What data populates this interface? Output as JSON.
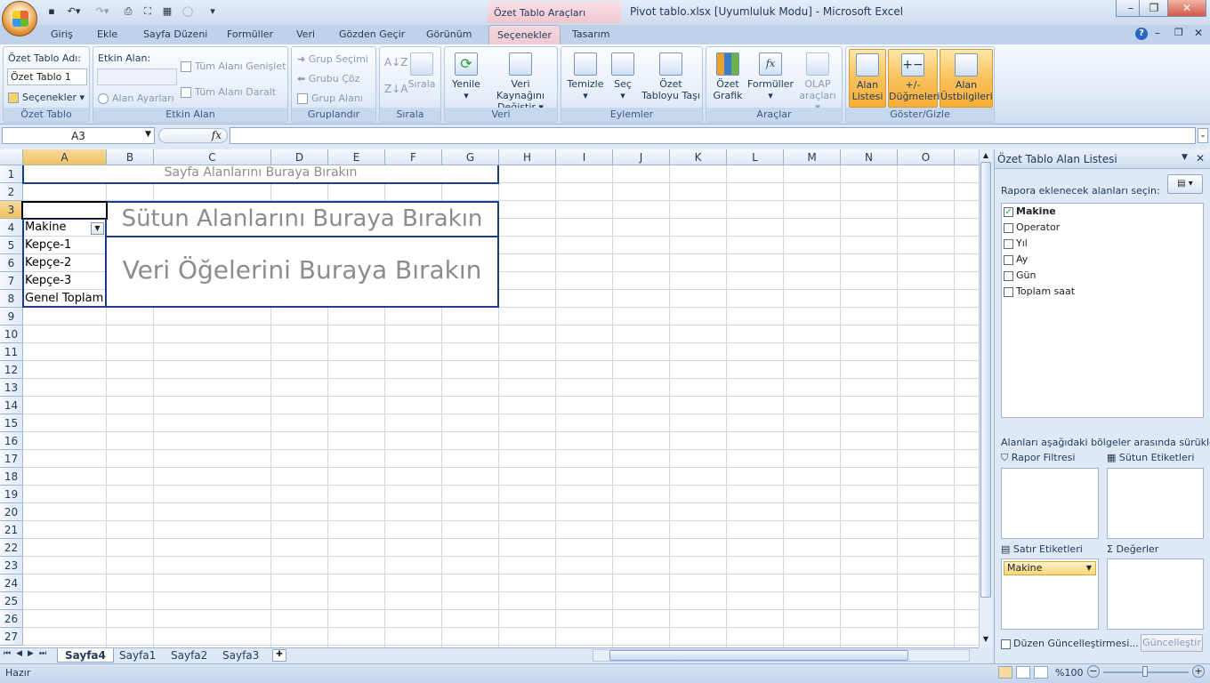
{
  "window": {
    "title": "Pivot tablo.xlsx  [Uyumluluk Modu] - Microsoft Excel",
    "contextual_tab_group": "Özet Tablo Araçları"
  },
  "tabs": [
    "Giriş",
    "Ekle",
    "Sayfa Düzeni",
    "Formüller",
    "Veri",
    "Gözden Geçir",
    "Görünüm",
    "Seçenekler",
    "Tasarım"
  ],
  "active_tab": "Seçenekler",
  "ribbon": {
    "ozet_tablo": {
      "name_label": "Özet Tablo Adı:",
      "name_value": "Özet Tablo 1",
      "options_label": "Seçenekler",
      "group_label": "Özet Tablo"
    },
    "etkin_alan": {
      "active_field_label": "Etkin Alan:",
      "field_settings": "Alan Ayarları",
      "expand_all": "Tüm Alanı Genişlet",
      "collapse_all": "Tüm Alanı Daralt",
      "group_label": "Etkin Alan"
    },
    "gruplandir": {
      "group_selection": "Grup Seçimi",
      "ungroup": "Grubu Çöz",
      "group_field": "Grup Alanı",
      "group_label": "Gruplandır"
    },
    "sirala": {
      "sort": "Sırala",
      "group_label": "Sırala"
    },
    "veri": {
      "refresh": "Yenile",
      "change_source_line1": "Veri Kaynağını",
      "change_source_line2": "Değiştir",
      "group_label": "Veri"
    },
    "eylemler": {
      "clear": "Temizle",
      "select": "Seç",
      "move_line1": "Özet",
      "move_line2": "Tabloyu Taşı",
      "group_label": "Eylemler"
    },
    "araclar": {
      "chart_line1": "Özet",
      "chart_line2": "Grafik",
      "formulas": "Formüller",
      "olap_line1": "OLAP",
      "olap_line2": "araçları",
      "group_label": "Araçlar"
    },
    "goster_gizle": {
      "field_list_line1": "Alan",
      "field_list_line2": "Listesi",
      "buttons_line1": "+/-",
      "buttons_line2": "Düğmeleri",
      "headers_line1": "Alan",
      "headers_line2": "Üstbilgileri",
      "group_label": "Göster/Gizle"
    }
  },
  "formula_bar": {
    "name_box": "A3",
    "fx": "fx",
    "value": ""
  },
  "sheet": {
    "columns": [
      "A",
      "B",
      "C",
      "D",
      "E",
      "F",
      "G",
      "H",
      "I",
      "J",
      "K",
      "L",
      "M",
      "N",
      "O"
    ],
    "rows": [
      "1",
      "2",
      "3",
      "4",
      "5",
      "6",
      "7",
      "8",
      "9",
      "10",
      "11",
      "12",
      "13",
      "14",
      "15",
      "16",
      "17",
      "18",
      "19",
      "20",
      "21",
      "22",
      "23",
      "24",
      "25",
      "26",
      "27"
    ],
    "page_fields_drop": "Sayfa Alanlarını Buraya Bırakın",
    "column_fields_drop": "Sütun Alanlarını Buraya Bırakın",
    "data_items_drop": "Veri Öğelerini Buraya Bırakın",
    "row_header": "Makine",
    "row_items": [
      "Kepçe-1",
      "Kepçe-2",
      "Kepçe-3"
    ],
    "grand_total": "Genel Toplam"
  },
  "sheet_tabs": [
    "Sayfa4",
    "Sayfa1",
    "Sayfa2",
    "Sayfa3"
  ],
  "active_sheet": "Sayfa4",
  "status": {
    "ready": "Hazır",
    "zoom": "%100"
  },
  "field_list": {
    "title": "Özet Tablo Alan Listesi",
    "choose_label": "Rapora eklenecek alanları seçin:",
    "fields": [
      {
        "name": "Makine",
        "checked": true
      },
      {
        "name": "Operator",
        "checked": false
      },
      {
        "name": "Yıl",
        "checked": false
      },
      {
        "name": "Ay",
        "checked": false
      },
      {
        "name": "Gün",
        "checked": false
      },
      {
        "name": "Toplam saat",
        "checked": false
      }
    ],
    "drag_label": "Alanları aşağıdaki bölgeler arasında sürükleyin:",
    "report_filter": "Rapor Filtresi",
    "column_labels": "Sütun Etiketleri",
    "row_labels": "Satır Etiketleri",
    "values": "Değerler",
    "row_field": "Makine",
    "defer_update": "Düzen Güncelleştirmesi...",
    "update_button": "Güncelleştir"
  }
}
